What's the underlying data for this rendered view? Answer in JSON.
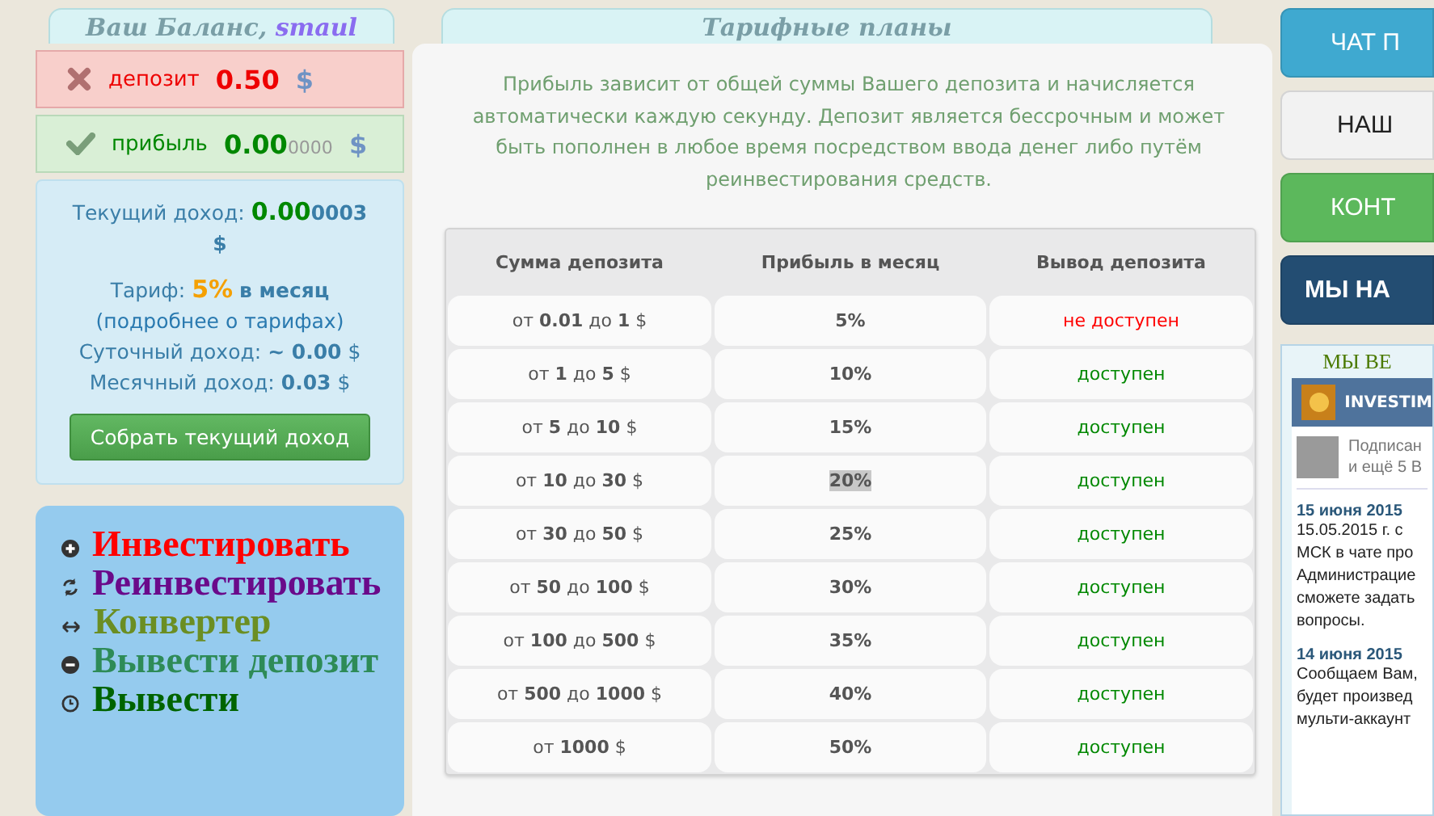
{
  "balance": {
    "title": "Ваш Баланс,",
    "username": "smaul",
    "rows": [
      {
        "kind": "deposit",
        "label": "депозит",
        "amount": "0.50",
        "fraction": "",
        "currency": "$"
      },
      {
        "kind": "profit",
        "label": "прибыль",
        "amount": "0.00",
        "fraction": "0000",
        "currency": "$"
      }
    ]
  },
  "income": {
    "current_label": "Текущий доход:",
    "current_value": "0.00",
    "current_fraction": "0003",
    "current_currency": "$",
    "tariff_label": "Тариф:",
    "tariff_value": "5%",
    "tariff_period": "в месяц",
    "tariff_link": "(подробнее о тарифах)",
    "daily_label": "Суточный доход:",
    "daily_value": "~ 0.00",
    "daily_currency": "$",
    "monthly_label": "Месячный доход:",
    "monthly_value": "0.03",
    "monthly_currency": "$",
    "collect_button": "Собрать текущий доход"
  },
  "menu": [
    {
      "kind": "plus",
      "label": "Инвестировать",
      "color": "#ff0000"
    },
    {
      "kind": "refresh",
      "label": "Реинвестировать",
      "color": "#6a0a8a"
    },
    {
      "kind": "arrows",
      "label": "Конвертер",
      "color": "#6b8e23"
    },
    {
      "kind": "minus",
      "label": "Вывести депозит",
      "color": "#2e8b57"
    },
    {
      "kind": "clock",
      "label": "Вывести",
      "color": "#006400"
    }
  ],
  "plans": {
    "title": "Тарифные планы",
    "intro": "Прибыль зависит от общей суммы Вашего депозита и начисляется автоматически каждую секунду. Депозит является бессрочным и может быть пополнен в любое время посредством ввода денег либо путём реинвестирования средств.",
    "columns": [
      "Сумма депозита",
      "Прибыль в месяц",
      "Вывод депозита"
    ],
    "rows": [
      {
        "range": "от **0.01** до **1** $",
        "profit": "5%",
        "withdrawal": "не доступен",
        "available": false,
        "highlighted": false
      },
      {
        "range": "от **1** до **5** $",
        "profit": "10%",
        "withdrawal": "доступен",
        "available": true,
        "highlighted": false
      },
      {
        "range": "от **5** до **10** $",
        "profit": "15%",
        "withdrawal": "доступен",
        "available": true,
        "highlighted": false
      },
      {
        "range": "от **10** до **30** $",
        "profit": "20%",
        "withdrawal": "доступен",
        "available": true,
        "highlighted": true
      },
      {
        "range": "от **30** до **50** $",
        "profit": "25%",
        "withdrawal": "доступен",
        "available": true,
        "highlighted": false
      },
      {
        "range": "от **50** до **100** $",
        "profit": "30%",
        "withdrawal": "доступен",
        "available": true,
        "highlighted": false
      },
      {
        "range": "от **100** до **500** $",
        "profit": "35%",
        "withdrawal": "доступен",
        "available": true,
        "highlighted": false
      },
      {
        "range": "от **500** до **1000** $",
        "profit": "40%",
        "withdrawal": "доступен",
        "available": true,
        "highlighted": false
      },
      {
        "range": "от **1000** $",
        "profit": "50%",
        "withdrawal": "доступен",
        "available": true,
        "highlighted": false
      }
    ]
  },
  "right": {
    "buttons": [
      {
        "label": "ЧАТ П",
        "color": "#3fa9d0"
      },
      {
        "label": "НАШ",
        "color": "#f2f2f2"
      },
      {
        "label": "КОНТ",
        "color": "#5cb85c"
      },
      {
        "label": "МЫ  НА",
        "color": "#234d72"
      }
    ],
    "widget": {
      "title": "МЫ ВЕ",
      "group": "INVESTIM",
      "subscribers": [
        "Подписан",
        "и ещё 5 В"
      ],
      "news": [
        {
          "date": "15 июня 2015",
          "lines": [
            "15.05.2015 г. с",
            "МСК в чате про",
            "Администрацие",
            "сможете задать",
            "вопросы."
          ]
        },
        {
          "date": "14 июня 2015",
          "lines": [
            "Сообщаем Вам,",
            "будет произвед",
            "мульти-аккаунт"
          ]
        }
      ]
    }
  }
}
